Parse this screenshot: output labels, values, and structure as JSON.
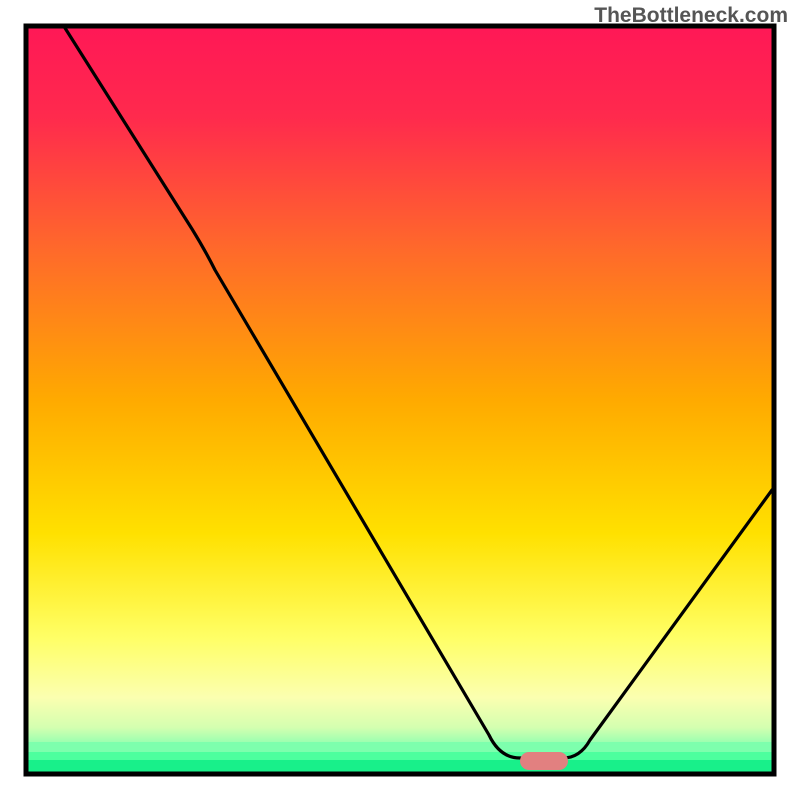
{
  "watermark": "TheBottleneck.com",
  "chart_data": {
    "type": "line",
    "title": "",
    "xlabel": "",
    "ylabel": "",
    "xlim": [
      0,
      100
    ],
    "ylim": [
      0,
      100
    ],
    "gradient_colors": {
      "top": "#ff1744",
      "upper_mid": "#ff6d00",
      "mid": "#ffd600",
      "lower_mid": "#ffff8d",
      "bottom": "#00e676"
    },
    "curve_points": [
      {
        "x": 5,
        "y": 100
      },
      {
        "x": 22,
        "y": 73
      },
      {
        "x": 62,
        "y": 5
      },
      {
        "x": 64,
        "y": 2
      },
      {
        "x": 72,
        "y": 2
      },
      {
        "x": 74,
        "y": 5
      },
      {
        "x": 95,
        "y": 38
      }
    ],
    "marker": {
      "x": 68,
      "y": 2,
      "color": "#e57373",
      "shape": "rounded-rect"
    },
    "notes": "V-shaped bottleneck curve over red-to-green vertical gradient background; minimum near x≈68; axes are black borders with no tick labels visible"
  }
}
